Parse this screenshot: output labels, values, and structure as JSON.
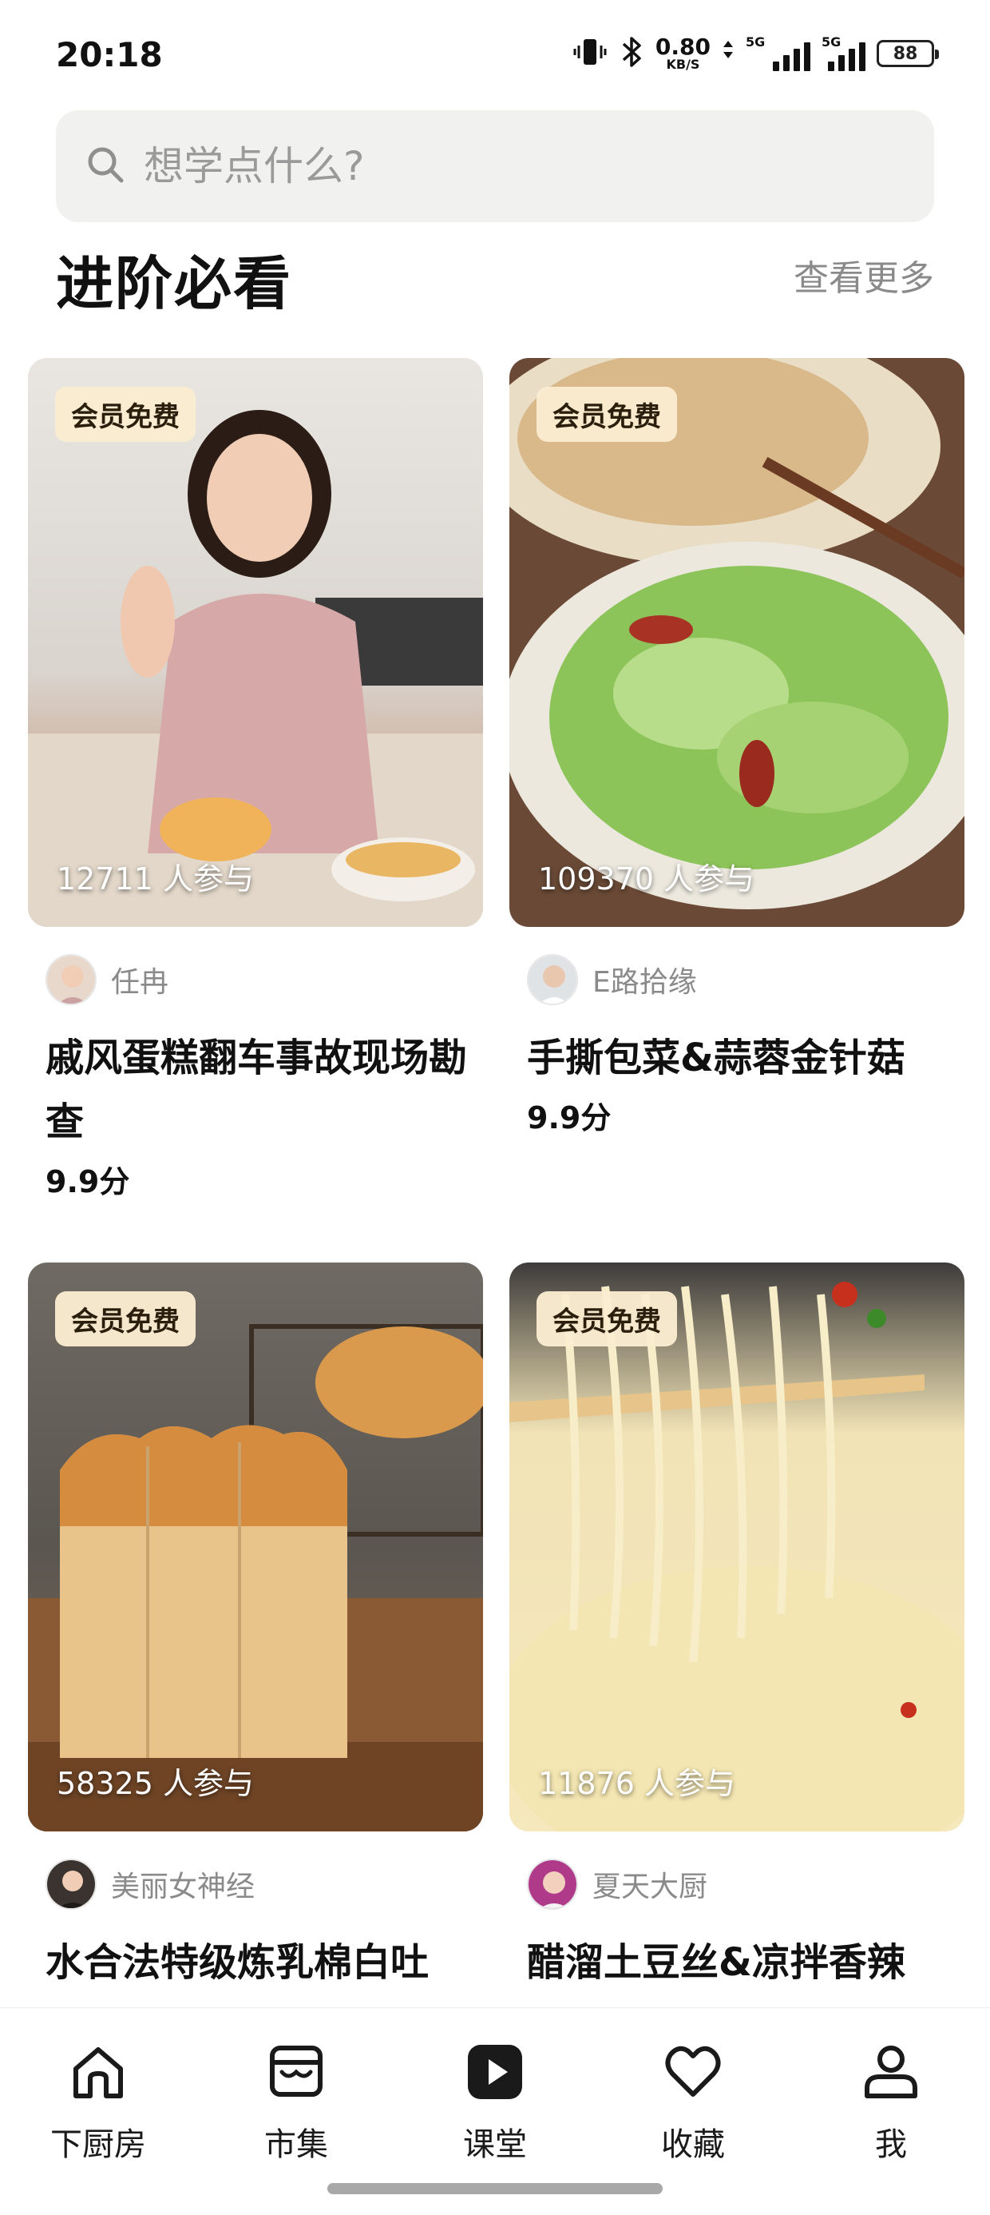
{
  "status_bar": {
    "time": "20:18",
    "net_speed": "0.80",
    "net_unit": "KB/S",
    "signal_label_1": "5G",
    "signal_label_2": "5G",
    "battery": "88",
    "icons": [
      "vibrate-icon",
      "bluetooth-icon",
      "signal-icon",
      "battery-icon"
    ]
  },
  "search": {
    "placeholder": "想学点什么?"
  },
  "section": {
    "title": "进阶必看",
    "see_more": "查看更多"
  },
  "cards": [
    {
      "badge": "会员免费",
      "participants": "12711 人参与",
      "author": "任冉",
      "title": "戚风蛋糕翻车事故现场勘查",
      "score": "9.9分"
    },
    {
      "badge": "会员免费",
      "participants": "109370 人参与",
      "author": "E路拾缘",
      "title": "手撕包菜&蒜蓉金针菇",
      "score": "9.9分"
    },
    {
      "badge": "会员免费",
      "participants": "58325 人参与",
      "author": "美丽女神经",
      "title": "水合法特级炼乳棉白吐",
      "score": ""
    },
    {
      "badge": "会员免费",
      "participants": "11876 人参与",
      "author": "夏天大厨",
      "title": "醋溜土豆丝&凉拌香辣",
      "score": ""
    }
  ],
  "nav": [
    {
      "label": "下厨房",
      "icon": "home-icon"
    },
    {
      "label": "市集",
      "icon": "market-icon"
    },
    {
      "label": "课堂",
      "icon": "video-play-icon"
    },
    {
      "label": "收藏",
      "icon": "heart-icon"
    },
    {
      "label": "我",
      "icon": "person-icon"
    }
  ],
  "colors": {
    "search_bg": "#f1f1ef",
    "badge_bg": "#faecd0",
    "muted_text": "#8a8a8a"
  }
}
